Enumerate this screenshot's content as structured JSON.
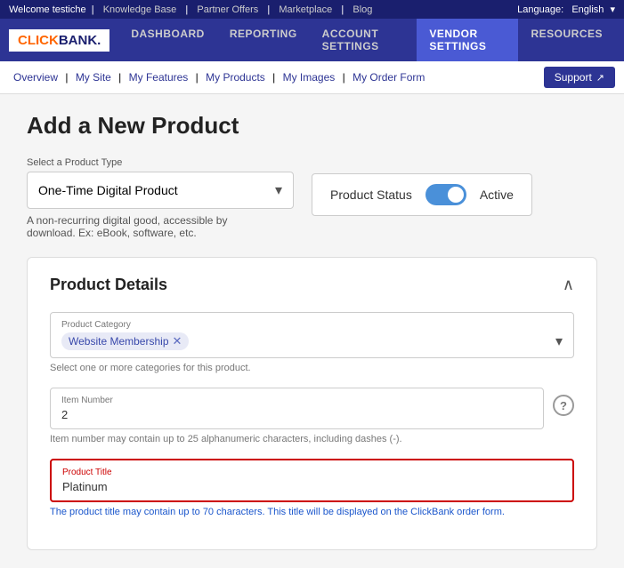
{
  "topBar": {
    "welcome": "Welcome testiche",
    "links": [
      "Knowledge Base",
      "Partner Offers",
      "Marketplace",
      "Blog"
    ],
    "languageLabel": "Language:",
    "language": "English"
  },
  "mainNav": {
    "logo": "CLICKBANK",
    "items": [
      {
        "label": "Dashboard",
        "active": false
      },
      {
        "label": "Reporting",
        "active": false
      },
      {
        "label": "Account Settings",
        "active": false
      },
      {
        "label": "Vendor Settings",
        "active": true
      },
      {
        "label": "Resources",
        "active": false
      }
    ]
  },
  "subNav": {
    "links": [
      "Overview",
      "My Site",
      "My Features",
      "My Products",
      "My Images",
      "My Order Form"
    ],
    "supportLabel": "Support"
  },
  "page": {
    "title": "Add a New Product",
    "productTypeLabel": "Select a Product Type",
    "productTypeValue": "One-Time Digital Product",
    "productTypeDesc": "A non-recurring digital good, accessible by download. Ex: eBook, software, etc.",
    "productStatusLabel": "Product Status",
    "productStatusValue": "Active"
  },
  "productDetails": {
    "sectionTitle": "Product Details",
    "categoryLabel": "Product Category",
    "categoryTag": "Website Membership",
    "categoryHint": "Select one or more categories for this product.",
    "itemNumberLabel": "Item Number",
    "itemNumberValue": "2",
    "itemNumberHint": "Item number may contain up to 25 alphanumeric characters, including dashes (-).",
    "productTitleLabel": "Product Title",
    "productTitleValue": "Platinum",
    "productTitleHint": "The product title may contain up to 70 characters. This title will be displayed on the ClickBank order form."
  }
}
